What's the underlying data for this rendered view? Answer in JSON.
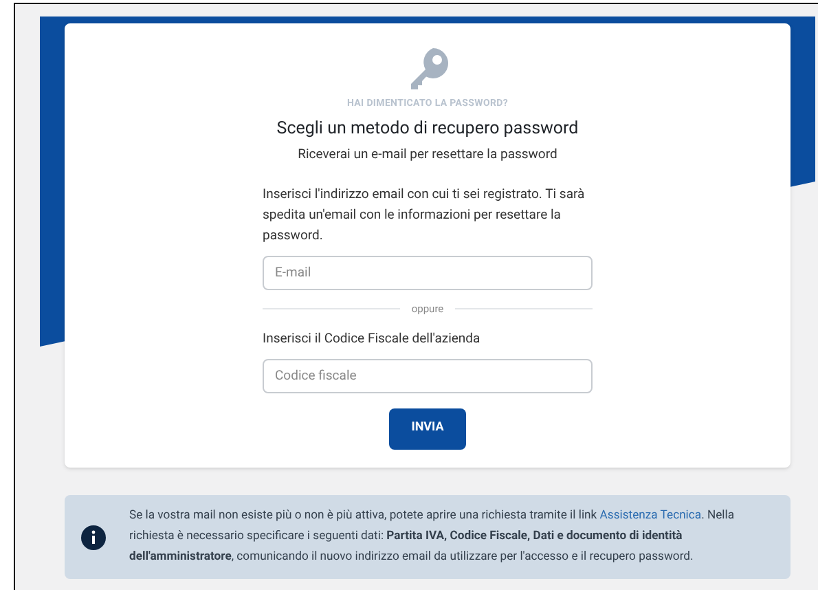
{
  "eyebrow": "HAI DIMENTICATO LA PASSWORD?",
  "title": "Scegli un metodo di recupero password",
  "subtitle": "Riceverai un e-mail per resettare la password",
  "email_section": {
    "instructions": "Inserisci l'indirizzo email con cui ti sei registrato. Ti sarà spedita un'email con le informazioni per resettare la password.",
    "placeholder": "E-mail"
  },
  "divider_label": "oppure",
  "tax_code_section": {
    "label": "Inserisci il Codice Fiscale dell'azienda",
    "placeholder": "Codice fiscale"
  },
  "submit_button": "INVIA",
  "info": {
    "text_before": "Se la vostra mail non esiste più o non è più attiva, potete aprire una richiesta tramite il link",
    "link": "Assistenza Tecnica",
    "text_after": ". Nella richiesta è necessario specificare i seguenti dati: **Partita IVA, Codice Fiscale, Dati e documento di identità dell'amministratore**, comunicando il nuovo indirizzo email da utilizzare per l'accesso e il recupero password."
  }
}
